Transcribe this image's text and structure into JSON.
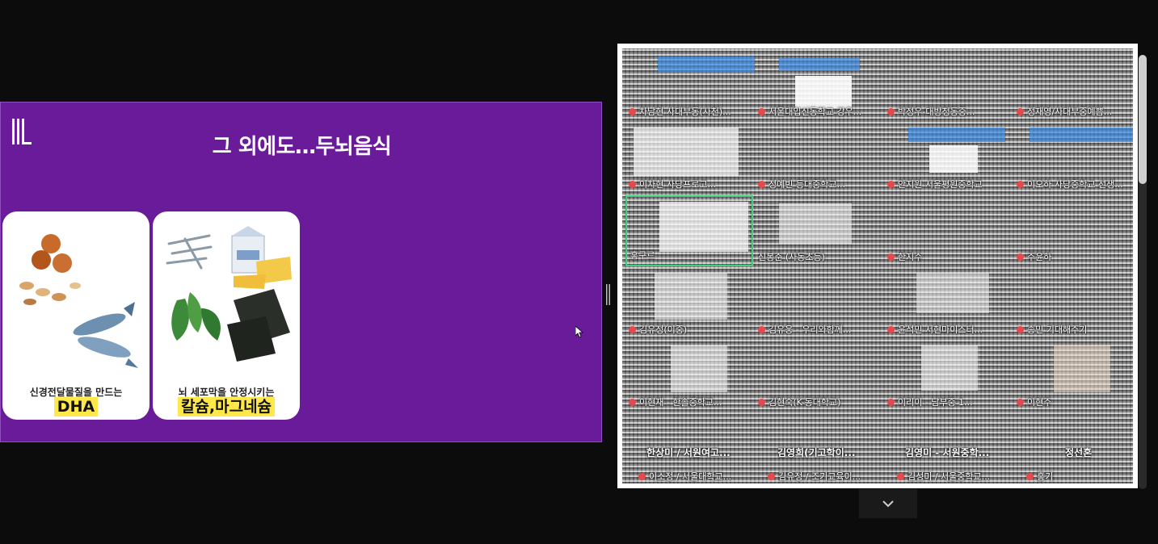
{
  "slide": {
    "title": "그 외에도…두뇌음식",
    "cards": [
      {
        "caption": "신경전달물질을 만드는",
        "highlight": "DHA"
      },
      {
        "caption": "뇌 세포막을 안정시키는",
        "highlight": "칼슘,마그네슘"
      }
    ],
    "accent_color": "#6a1b9a",
    "highlight_color": "#ffe94a",
    "logo_icon": "ls-logo-icon"
  },
  "gallery": {
    "tiles": [
      {
        "name": "차남현 사대부동(사천)..."
      },
      {
        "name": "서울대입신동학교 강우..."
      },
      {
        "name": "박정우-대방청동중..."
      },
      {
        "name": "정재영/사대부중예쁨..."
      },
      {
        "name": "이차현 사당프로고..."
      },
      {
        "name": "정예빈 등대중학교..."
      },
      {
        "name": "안지원 서울평원중학교"
      },
      {
        "name": "이오하 사당중학교 선생..."
      },
      {
        "name": "홍구르"
      },
      {
        "name": "신봉준 (사동초등)"
      },
      {
        "name": "한지수"
      },
      {
        "name": "주윤하"
      },
      {
        "name": "김유정(이중)"
      },
      {
        "name": "김유웅 - 우리와함께..."
      },
      {
        "name": "윤석민 서현마이스터..."
      },
      {
        "name": "송민 기대해주기"
      },
      {
        "name": "이현재 - 한솔중학교..."
      },
      {
        "name": "김현숙(K-동대학교)"
      },
      {
        "name": "이리이 - 남부중 1..."
      },
      {
        "name": "이현주"
      }
    ],
    "big_names": [
      "한상미 / 서원여고...",
      "김영희(기고학이...",
      "김영미 - 서원중학...",
      "정선혼"
    ],
    "bottom_names": [
      "이소정 / 서울대학교...",
      "김유정 / 조기교육이...",
      "김성미 / 서울중학교...",
      "홍기"
    ]
  },
  "icons": {
    "cursor": "cursor-arrow-icon",
    "splitter": "splitter-handle-icon",
    "page_down": "chevron-down-icon",
    "mic": "mic-off-icon"
  }
}
